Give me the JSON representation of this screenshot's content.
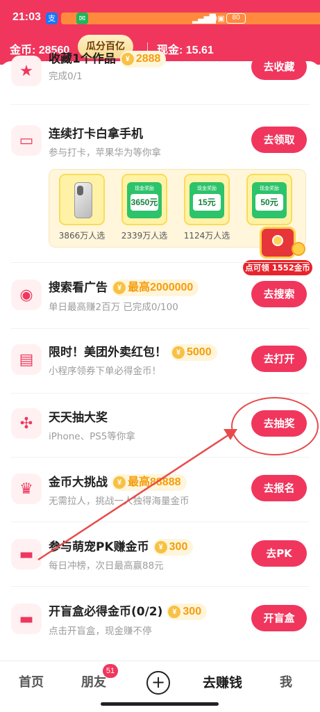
{
  "status_bar": {
    "time": "21:03",
    "battery": "80",
    "signal": "5G"
  },
  "header": {
    "coins_label": "金币: 28560",
    "guafen_button": "瓜分百亿",
    "cash_label": "现金: 15.61"
  },
  "tasks": [
    {
      "title": "收藏1个作品",
      "reward": "2888",
      "subtitle": "完成0/1",
      "button": "去收藏",
      "icon": "star-icon"
    },
    {
      "title": "连续打卡白拿手机",
      "reward": "",
      "subtitle": "参与打卡，苹果华为等你拿",
      "button": "去领取",
      "icon": "gift-card-icon"
    },
    {
      "title": "搜索看广告",
      "reward": "最高2000000",
      "subtitle": "单日最高赚2百万 已完成0/100",
      "button": "去搜索",
      "icon": "search-play-icon"
    },
    {
      "title": "限时！美团外卖红包！",
      "reward": "5000",
      "subtitle": "小程序领券下单必得金币！",
      "button": "去打开",
      "icon": "shop-icon"
    },
    {
      "title": "天天抽大奖",
      "reward": "",
      "subtitle": "iPhone、PS5等你拿",
      "button": "去抽奖",
      "icon": "lottery-wheel-icon"
    },
    {
      "title": "金币大挑战",
      "reward": "最高88888",
      "subtitle": "无需拉人，挑战一人独得海量金币",
      "button": "去报名",
      "icon": "trophy-icon"
    },
    {
      "title": "参与萌宠PK赚金币",
      "reward": "300",
      "subtitle": "每日冲榜，次日最高赢88元",
      "button": "去PK",
      "icon": "pet-red-box-icon"
    },
    {
      "title": "开盲盒必得金币(0/2)",
      "reward": "300",
      "subtitle": "点击开盲盒，现金赚不停",
      "button": "开盲盒",
      "icon": "blind-box-icon"
    }
  ],
  "checkin_card": {
    "prizes": [
      {
        "kind": "phone",
        "label": "",
        "amount": "",
        "caption": "3866万人选"
      },
      {
        "kind": "cash",
        "label": "现金奖励",
        "amount": "3650元",
        "caption": "2339万人选"
      },
      {
        "kind": "cash",
        "label": "现金奖励",
        "amount": "15元",
        "caption": "1124万人选"
      },
      {
        "kind": "cash",
        "label": "现金奖励",
        "amount": "50元",
        "caption": ""
      }
    ],
    "chest_badge": "点可领 1552金币"
  },
  "tabbar": {
    "tabs": [
      {
        "label": "首页"
      },
      {
        "label": "朋友",
        "badge": "51"
      },
      {
        "label": "+"
      },
      {
        "label": "去赚钱"
      },
      {
        "label": "我"
      }
    ]
  },
  "colors": {
    "brand": "#f0365d",
    "reward": "#f59d0b",
    "annotation": "#e84a4a"
  }
}
